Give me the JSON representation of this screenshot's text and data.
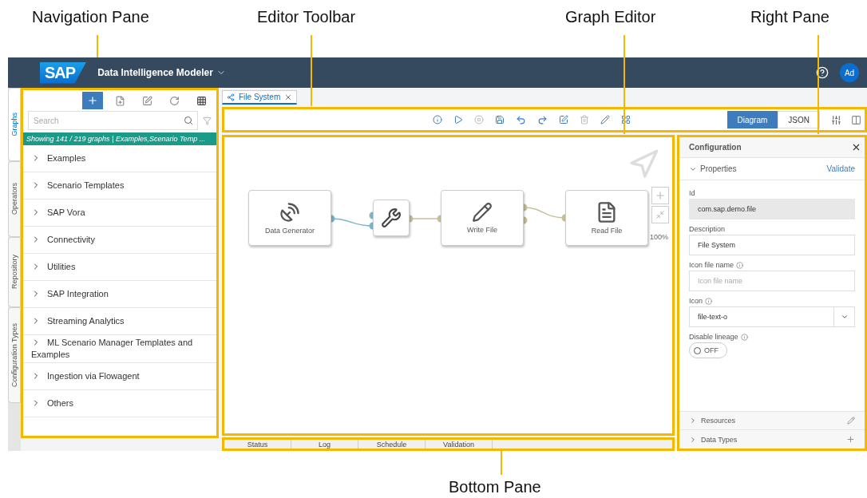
{
  "callouts_top": [
    "Navigation Pane",
    "Editor Toolbar",
    "Graph Editor",
    "Right Pane"
  ],
  "callout_bottom": "Bottom Pane",
  "header": {
    "logo": "SAP",
    "title": "Data Intelligence Modeler",
    "avatar": "Ad"
  },
  "side_tabs": [
    {
      "label": "Graphs",
      "selected": true
    },
    {
      "label": "Operators",
      "selected": false
    },
    {
      "label": "Repository",
      "selected": false
    },
    {
      "label": "Configuration Types",
      "selected": false
    }
  ],
  "navigation": {
    "search": {
      "placeholder": "Search"
    },
    "filter_info": "Showing 141 / 219 graphs | Examples,Scenario Temp ...",
    "items": [
      {
        "label": "Examples"
      },
      {
        "label": "Scenario Templates"
      },
      {
        "label": "SAP Vora"
      },
      {
        "label": "Connectivity"
      },
      {
        "label": "Utilities"
      },
      {
        "label": "SAP Integration"
      },
      {
        "label": "Streaming Analytics"
      },
      {
        "label": "ML Scenario Manager Templates and Examples"
      },
      {
        "label": "Ingestion via Flowagent"
      },
      {
        "label": "Others"
      }
    ]
  },
  "editor_tab": {
    "label": "File System"
  },
  "view_modes": [
    {
      "label": "Diagram",
      "selected": true
    },
    {
      "label": "JSON",
      "selected": false
    }
  ],
  "graph": {
    "nodes": [
      {
        "kind": "generator",
        "label": "Data Generator"
      },
      {
        "kind": "tool"
      },
      {
        "kind": "write",
        "label": "Write File"
      },
      {
        "kind": "read",
        "label": "Read File"
      }
    ],
    "zoom": "100%"
  },
  "bottom_tabs": [
    "Status",
    "Log",
    "Schedule",
    "Validation"
  ],
  "configuration": {
    "title": "Configuration",
    "section": {
      "label": "Properties",
      "expanded": true,
      "action": "Validate"
    },
    "fields": [
      {
        "kind": "readonly",
        "label": "Id",
        "value": "com.sap.demo.file"
      },
      {
        "kind": "text",
        "label": "Description",
        "value": "File System"
      },
      {
        "kind": "text",
        "label": "Icon file name",
        "info": true,
        "placeholder": "Icon file name"
      },
      {
        "kind": "select",
        "label": "Icon",
        "info": true,
        "value": "file-text-o"
      },
      {
        "kind": "toggle",
        "label": "Disable lineage",
        "info": true,
        "on": false,
        "state_text": "OFF"
      }
    ],
    "collapsed_sections": [
      {
        "label": "Resources",
        "kind": "edit"
      },
      {
        "label": "Data Types",
        "kind": "add"
      }
    ]
  }
}
